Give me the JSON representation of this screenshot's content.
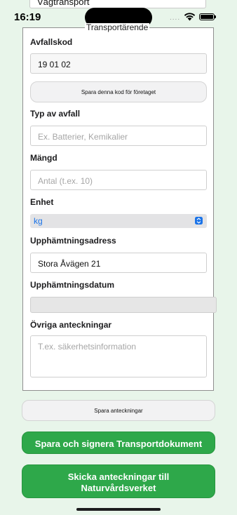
{
  "header": {
    "top_field_value": "Vägtransport",
    "time": "16:19",
    "status_dots": "....",
    "legend": "Transportärende"
  },
  "form": {
    "waste_code": {
      "label": "Avfallskod",
      "value": "19 01 02"
    },
    "save_code_button": "Spara denna kod för företaget",
    "waste_type": {
      "label": "Typ av avfall",
      "placeholder": "Ex. Batterier, Kemikalier"
    },
    "quantity": {
      "label": "Mängd",
      "placeholder": "Antal (t.ex. 10)"
    },
    "unit": {
      "label": "Enhet",
      "selected": "kg"
    },
    "pickup_address": {
      "label": "Upphämtningsadress",
      "value": "Stora Åvägen 21"
    },
    "pickup_date": {
      "label": "Upphämtningsdatum",
      "value": ""
    },
    "other_notes": {
      "label": "Övriga anteckningar",
      "placeholder": "T.ex. säkerhetsinformation"
    }
  },
  "actions": {
    "save_notes": "Spara anteckningar",
    "save_and_sign": "Spara och signera Transportdokument",
    "send_notes_line1": "Skicka anteckningar till",
    "send_notes_line2": "Naturvårdsverket"
  },
  "colors": {
    "background": "#e8f5ea",
    "primary_green": "#2ea84a",
    "select_text": "#1a73e8"
  }
}
